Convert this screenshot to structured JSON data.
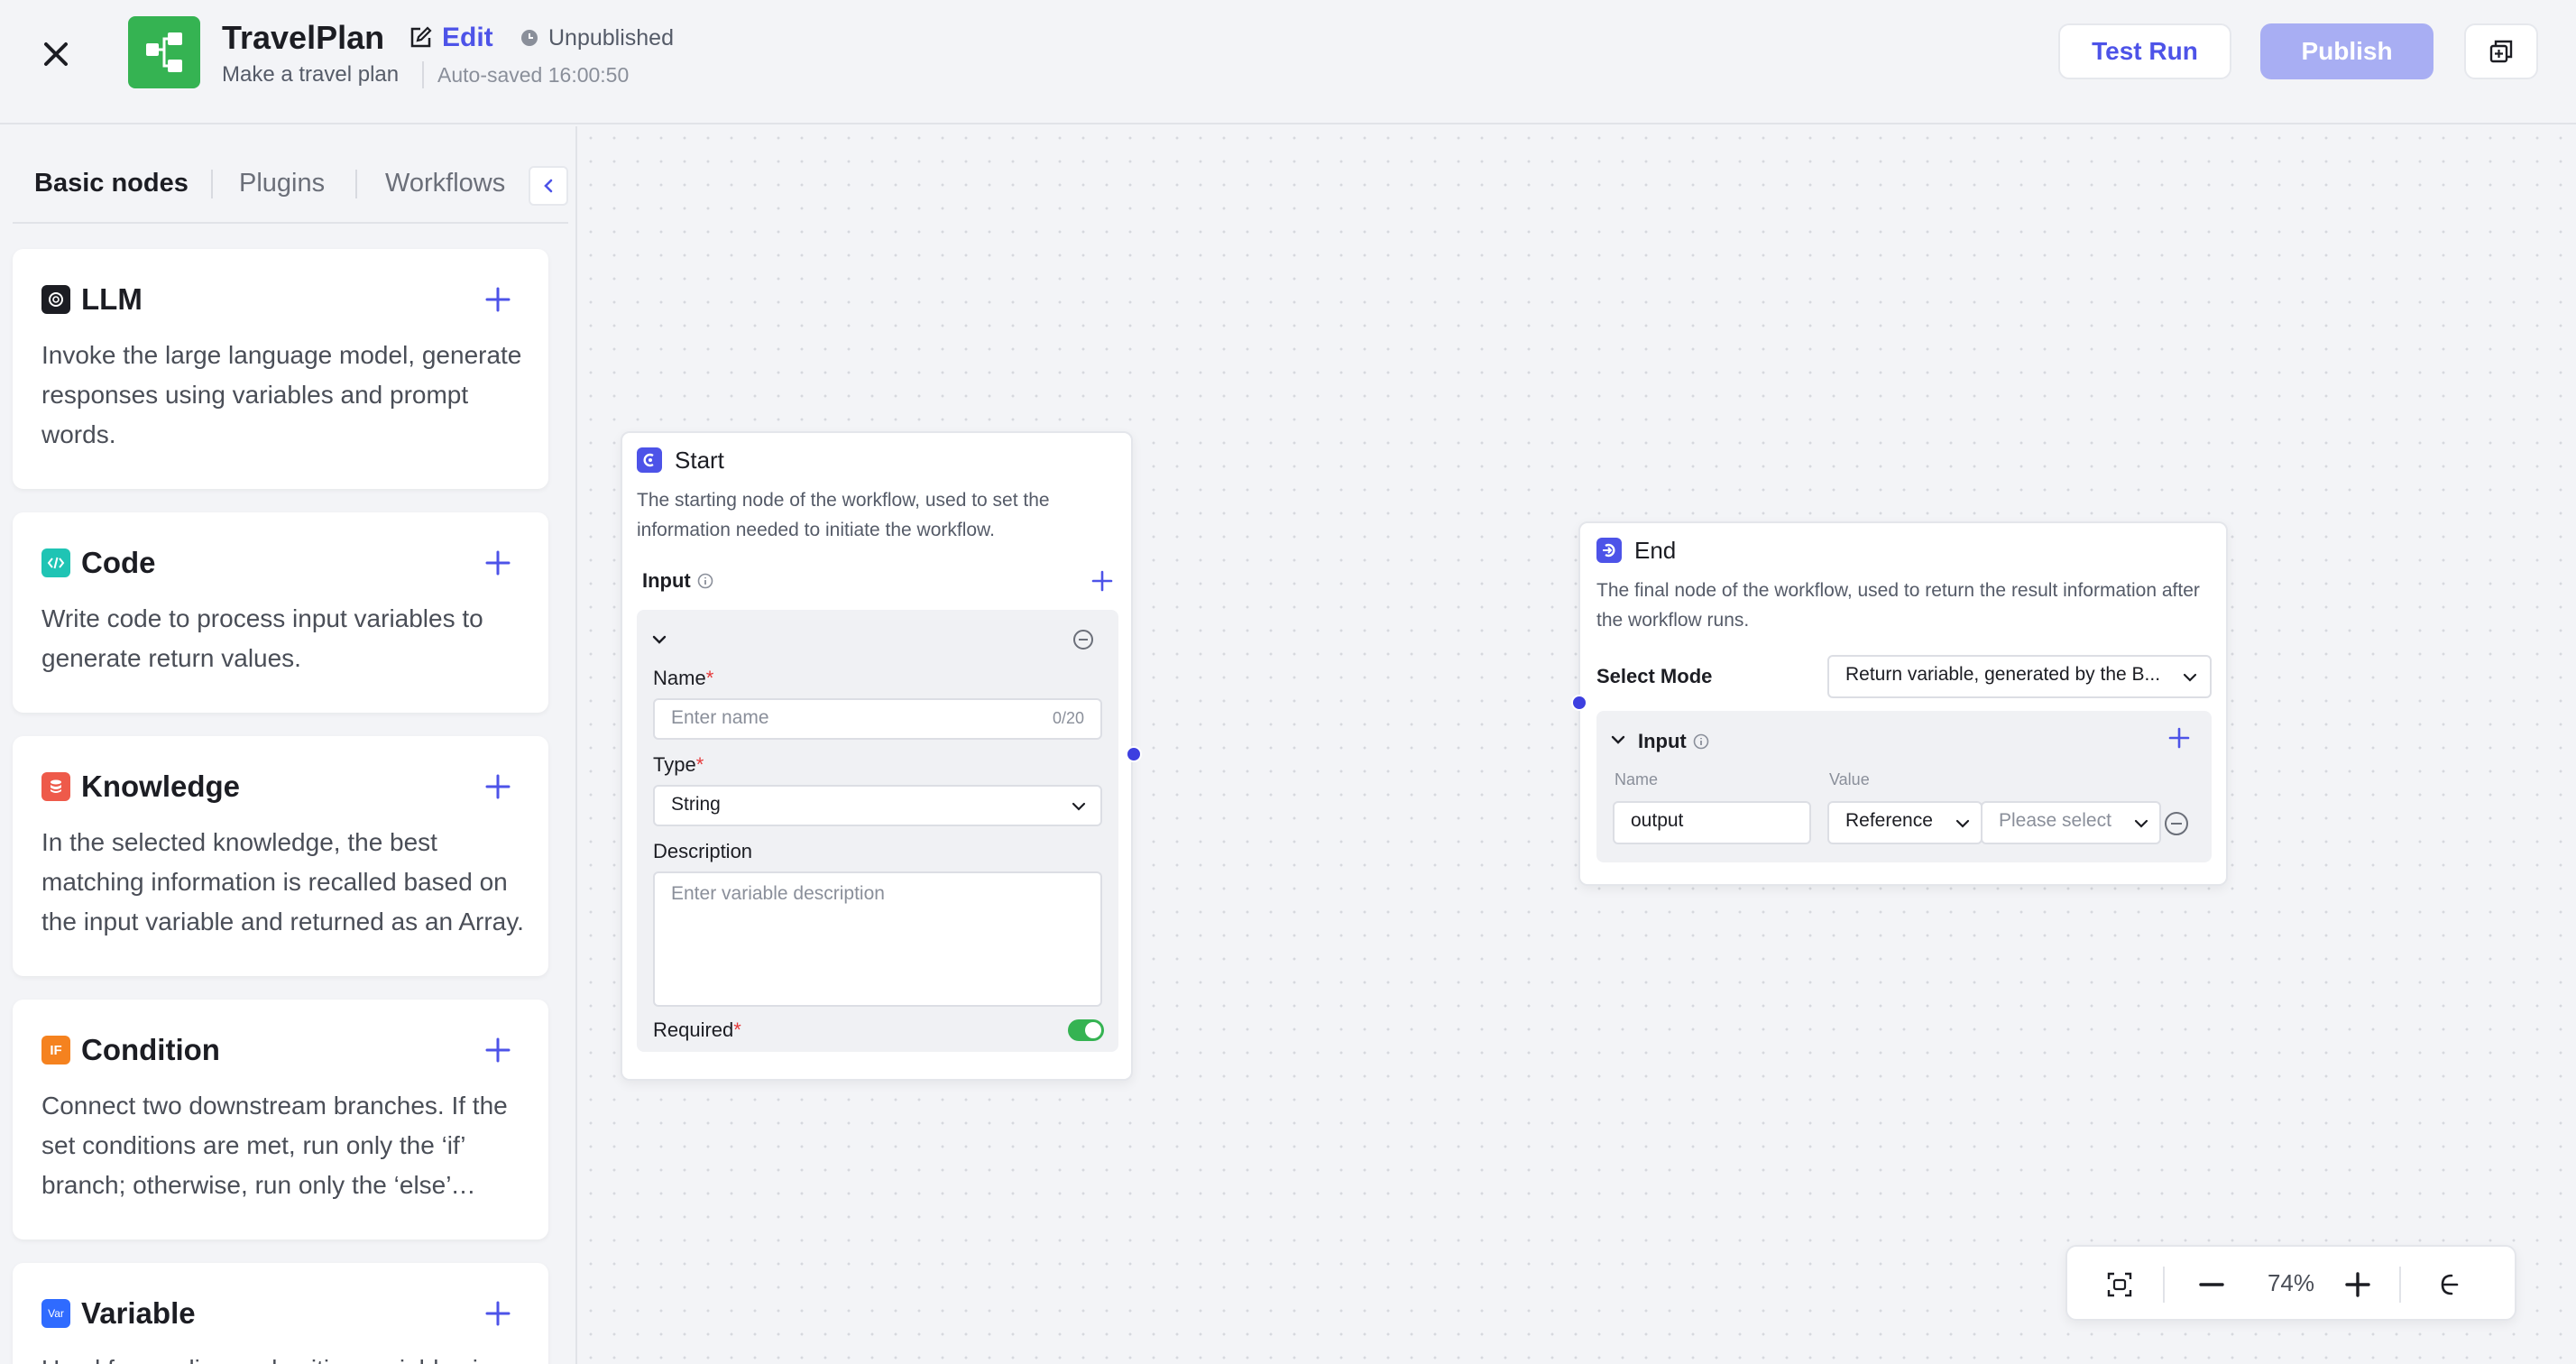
{
  "header": {
    "app_title": "TravelPlan",
    "edit_label": "Edit",
    "status": "Unpublished",
    "description": "Make a travel plan",
    "autosave": "Auto-saved 16:00:50",
    "test_run_label": "Test Run",
    "publish_label": "Publish"
  },
  "sidebar": {
    "tabs": [
      "Basic nodes",
      "Plugins",
      "Workflows"
    ],
    "active_tab": "Basic nodes",
    "nodes": [
      {
        "icon": "llm-icon",
        "title": "LLM",
        "description": "Invoke the large language model, generate responses using variables and prompt words.",
        "color": "#1c1d23"
      },
      {
        "icon": "code-icon",
        "title": "Code",
        "description": "Write code to process input variables to generate return values.",
        "color": "#1fc4b4"
      },
      {
        "icon": "knowledge-icon",
        "title": "Knowledge",
        "description": "In the selected knowledge, the best matching information is recalled based on the input variable and returned as an Array.",
        "color": "#ee5a4a"
      },
      {
        "icon": "condition-icon",
        "icon_text": "IF",
        "title": "Condition",
        "description": "Connect two downstream branches. If the set conditions are met, run only the ‘if’ branch; otherwise, run only the ‘else’ branch.",
        "color": "#f5821f"
      },
      {
        "icon": "variable-icon",
        "icon_text": "Var",
        "title": "Variable",
        "description": "Used for reading and writing variables in your bot.",
        "color": "#2f6bff"
      }
    ]
  },
  "start_node": {
    "title": "Start",
    "description": "The starting node of the workflow, used to set the information needed to initiate the workflow.",
    "input_label": "Input",
    "name_label": "Name",
    "name_placeholder": "Enter name",
    "name_counter": "0/20",
    "type_label": "Type",
    "type_value": "String",
    "description_label": "Description",
    "description_placeholder": "Enter variable description",
    "required_label": "Required",
    "required": true
  },
  "end_node": {
    "title": "End",
    "description": "The final node of the workflow, used to return the result information after the workflow runs.",
    "select_mode_label": "Select Mode",
    "select_mode_value": "Return variable, generated by the B...",
    "input_label": "Input",
    "col_name": "Name",
    "col_value": "Value",
    "row_name": "output",
    "row_type": "Reference",
    "row_value_placeholder": "Please select"
  },
  "zoom": {
    "level": "74%"
  },
  "colors": {
    "accent": "#4d53e8",
    "logo_green": "#35b352",
    "publish_disabled": "#a8aef3"
  }
}
